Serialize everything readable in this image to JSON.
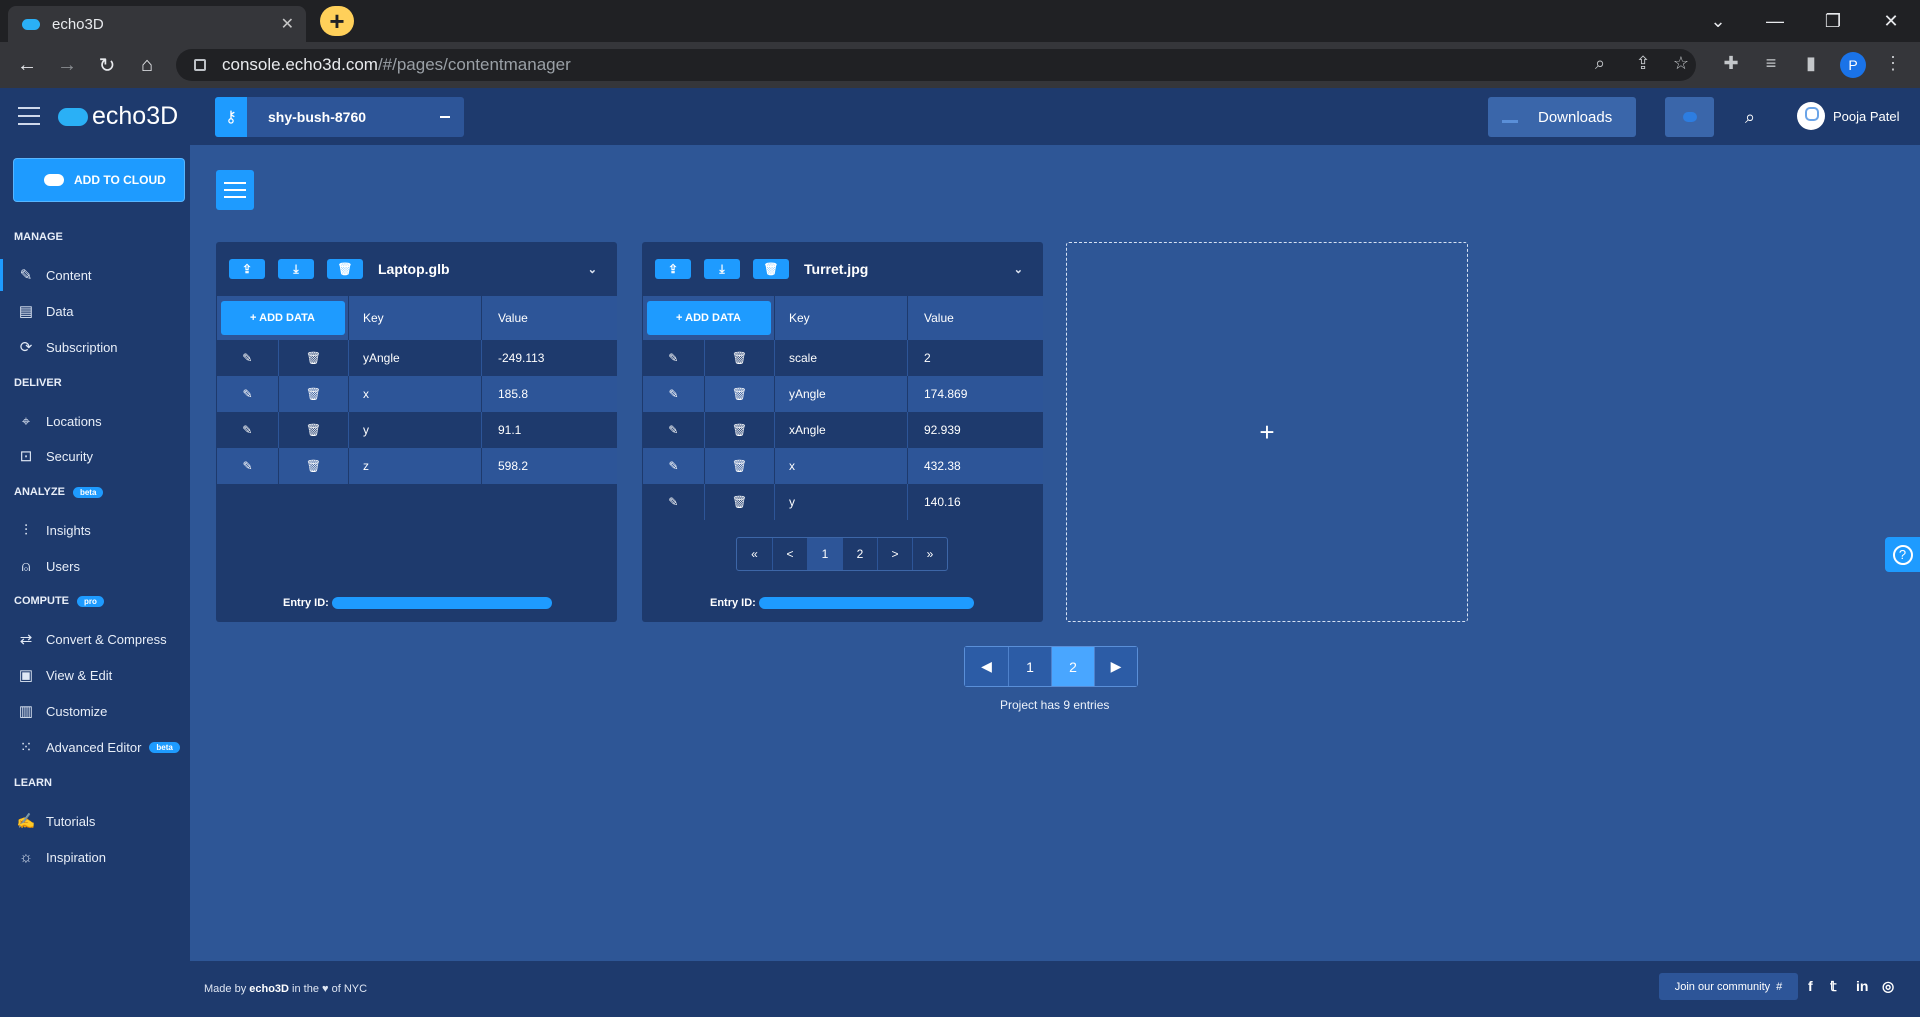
{
  "browser": {
    "tab_title": "echo3D",
    "tab_close": "✕",
    "new_tab": "+",
    "url_host": "console.echo3d.com",
    "url_path": "/#/pages/contentmanager",
    "profile_initial": "P"
  },
  "appbar": {
    "logo_text": "echo3D",
    "api_key_name": "shy-bush-8760",
    "downloads_label": "Downloads",
    "user_name": "Pooja Patel"
  },
  "sidebar": {
    "add_to_cloud": "ADD TO CLOUD",
    "manage_label": "MANAGE",
    "deliver_label": "DELIVER",
    "analyze_label": "ANALYZE",
    "analyze_badge": "beta",
    "compute_label": "COMPUTE",
    "compute_badge": "pro",
    "learn_label": "LEARN",
    "items": {
      "content": "Content",
      "data": "Data",
      "subscription": "Subscription",
      "locations": "Locations",
      "security": "Security",
      "insights": "Insights",
      "users": "Users",
      "convert": "Convert & Compress",
      "view_edit": "View & Edit",
      "customize": "Customize",
      "advanced_editor": "Advanced Editor",
      "advanced_badge": "beta",
      "tutorials": "Tutorials",
      "inspiration": "Inspiration"
    }
  },
  "cards": [
    {
      "title": "Laptop.glb",
      "add_data": "+ ADD DATA",
      "key_header": "Key",
      "value_header": "Value",
      "rows": [
        {
          "key": "yAngle",
          "value": "-249.113"
        },
        {
          "key": "x",
          "value": "185.8"
        },
        {
          "key": "y",
          "value": "91.1"
        },
        {
          "key": "z",
          "value": "598.2"
        }
      ],
      "entry_label": "Entry ID:"
    },
    {
      "title": "Turret.jpg",
      "add_data": "+ ADD DATA",
      "key_header": "Key",
      "value_header": "Value",
      "rows": [
        {
          "key": "scale",
          "value": "2"
        },
        {
          "key": "yAngle",
          "value": "174.869"
        },
        {
          "key": "xAngle",
          "value": "92.939"
        },
        {
          "key": "x",
          "value": "432.38"
        },
        {
          "key": "y",
          "value": "140.16"
        }
      ],
      "pager": [
        "«",
        "<",
        "1",
        "2",
        ">",
        "»"
      ],
      "entry_label": "Entry ID:"
    }
  ],
  "new_card_plus": "+",
  "main_pager": {
    "prev": "◀",
    "pages": [
      "1",
      "2"
    ],
    "current": "2",
    "next": "▶"
  },
  "entries_text": "Project has 9 entries",
  "footer": {
    "made_prefix": "Made by ",
    "made_brand": "echo3D",
    "made_middle": " in the ",
    "made_heart": "♥",
    "made_suffix": " of NYC",
    "community": "Join our community"
  }
}
